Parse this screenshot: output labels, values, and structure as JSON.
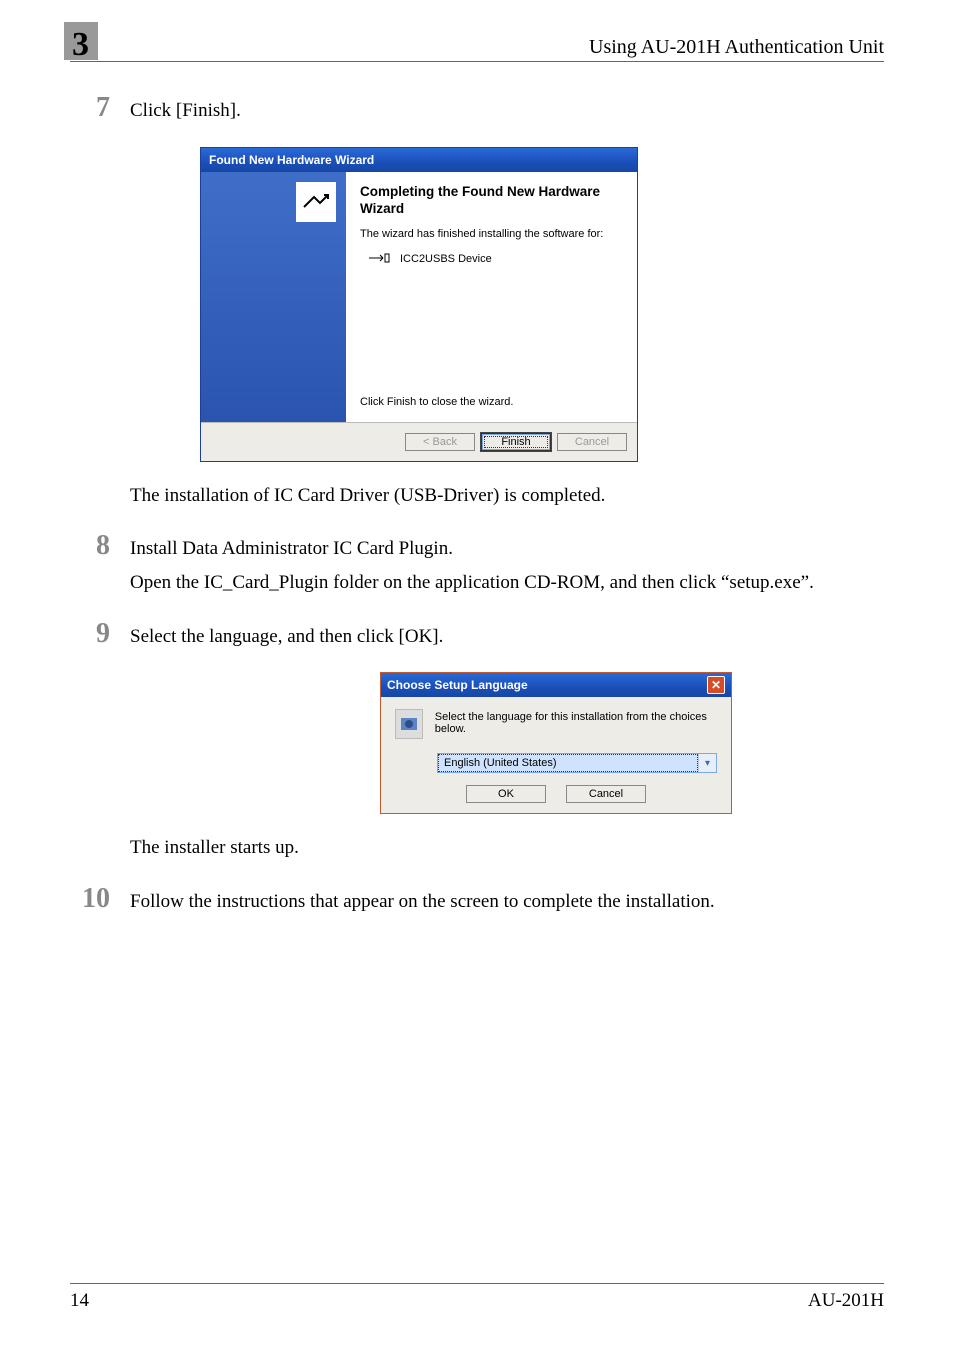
{
  "header": {
    "chapter": "3",
    "title": "Using AU-201H Authentication Unit"
  },
  "steps": [
    {
      "num": "7",
      "lines": [
        "Click [Finish]."
      ],
      "after": "The installation of IC Card Driver (USB-Driver) is completed."
    },
    {
      "num": "8",
      "lines": [
        "Install Data Administrator IC Card Plugin.",
        "Open the IC_Card_Plugin folder on the application CD-ROM, and then click “setup.exe”."
      ]
    },
    {
      "num": "9",
      "lines": [
        "Select the language, and then click [OK]."
      ],
      "after": "The installer starts up."
    },
    {
      "num": "10",
      "lines": [
        "Follow the instructions that appear on the screen to complete the installation."
      ]
    }
  ],
  "wizard": {
    "title": "Found New Hardware Wizard",
    "heading": "Completing the Found New Hardware Wizard",
    "finishedText": "The wizard has finished installing the software for:",
    "device": "ICC2USBS Device",
    "clickFinish": "Click Finish to close the wizard.",
    "buttons": {
      "back": "< Back",
      "finish": "Finish",
      "cancel": "Cancel"
    }
  },
  "langDialog": {
    "title": "Choose Setup Language",
    "text": "Select the language for this installation from the choices below.",
    "selected": "English (United States)",
    "buttons": {
      "ok": "OK",
      "cancel": "Cancel"
    }
  },
  "footer": {
    "page": "14",
    "model": "AU-201H"
  }
}
